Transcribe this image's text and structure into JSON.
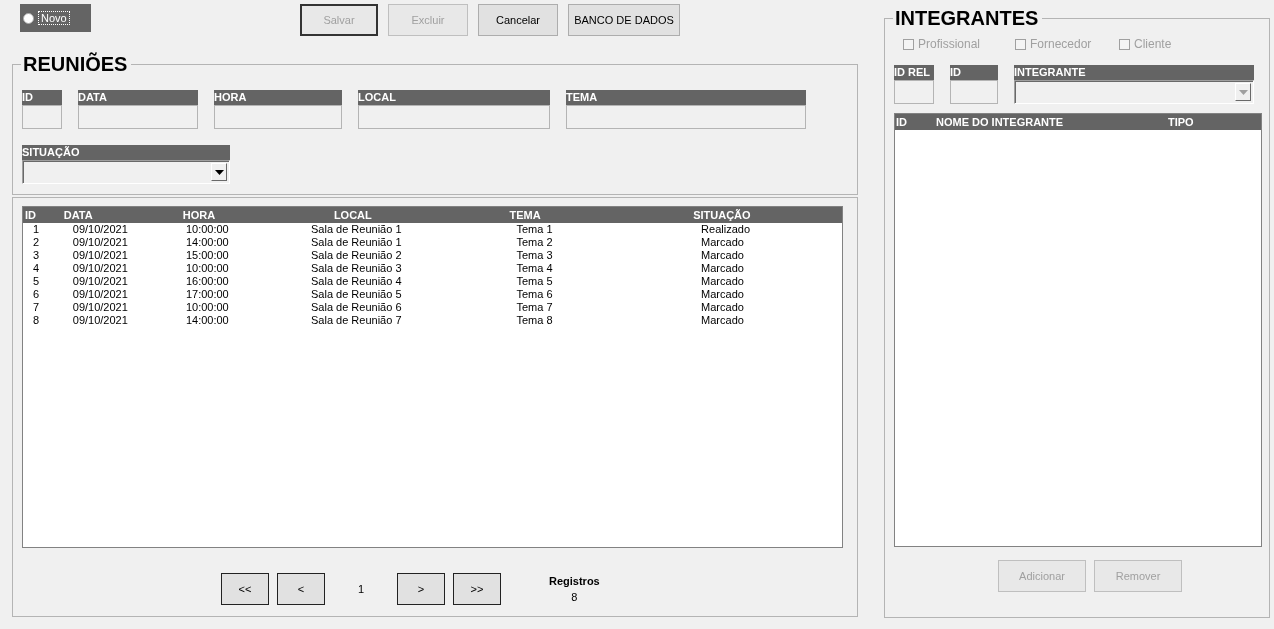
{
  "novo": {
    "label": "Novo",
    "selected": false
  },
  "toolbar": [
    {
      "label": "Salvar",
      "disabled": true,
      "default": true
    },
    {
      "label": "Excluir",
      "disabled": true,
      "default": false
    },
    {
      "label": "Cancelar",
      "disabled": false,
      "default": false
    },
    {
      "label": "BANCO DE DADOS",
      "disabled": false,
      "default": false
    }
  ],
  "reunioes": {
    "title": "REUNIÕES",
    "fields": [
      {
        "label": "ID",
        "kind": "text"
      },
      {
        "label": "DATA",
        "kind": "text"
      },
      {
        "label": "HORA",
        "kind": "text"
      },
      {
        "label": "LOCAL",
        "kind": "text"
      },
      {
        "label": "TEMA",
        "kind": "text"
      }
    ],
    "situacao": {
      "label": "SITUAÇÃO",
      "kind": "select",
      "disabled": false
    }
  },
  "table": {
    "columns": [
      "ID",
      "DATA",
      "HORA",
      "LOCAL",
      "TEMA",
      "SITUAÇÃO"
    ],
    "rows": [
      [
        "1",
        "09/10/2021",
        "10:00:00",
        "Sala de Reunião 1",
        "Tema 1",
        "Realizado"
      ],
      [
        "2",
        "09/10/2021",
        "14:00:00",
        "Sala de Reunião 1",
        "Tema 2",
        "Marcado"
      ],
      [
        "3",
        "09/10/2021",
        "15:00:00",
        "Sala de Reunião 2",
        "Tema 3",
        "Marcado"
      ],
      [
        "4",
        "09/10/2021",
        "10:00:00",
        "Sala de Reunião 3",
        "Tema 4",
        "Marcado"
      ],
      [
        "5",
        "09/10/2021",
        "16:00:00",
        "Sala de Reunião 4",
        "Tema 5",
        "Marcado"
      ],
      [
        "6",
        "09/10/2021",
        "17:00:00",
        "Sala de Reunião 5",
        "Tema 6",
        "Marcado"
      ],
      [
        "7",
        "09/10/2021",
        "10:00:00",
        "Sala de Reunião 6",
        "Tema 7",
        "Marcado"
      ],
      [
        "8",
        "09/10/2021",
        "14:00:00",
        "Sala de Reunião 7",
        "Tema 8",
        "Marcado"
      ]
    ]
  },
  "pagination": {
    "first": "<<",
    "prev": "<",
    "page": "1",
    "next": ">",
    "last": ">>",
    "records_label": "Registros",
    "records_count": "8"
  },
  "integrantes": {
    "title": "INTEGRANTES",
    "filters": [
      {
        "label": "Profissional",
        "checked": false,
        "disabled": true
      },
      {
        "label": "Fornecedor",
        "checked": false,
        "disabled": true
      },
      {
        "label": "Cliente",
        "checked": false,
        "disabled": true
      }
    ],
    "fields": [
      {
        "label": "ID REL",
        "kind": "text"
      },
      {
        "label": "ID",
        "kind": "text"
      },
      {
        "label": "INTEGRANTE",
        "kind": "select",
        "disabled": true
      }
    ],
    "columns": [
      "ID",
      "NOME DO INTEGRANTE",
      "TIPO"
    ],
    "buttons": [
      {
        "label": "Adicionar",
        "disabled": true
      },
      {
        "label": "Remover",
        "disabled": true
      }
    ]
  }
}
